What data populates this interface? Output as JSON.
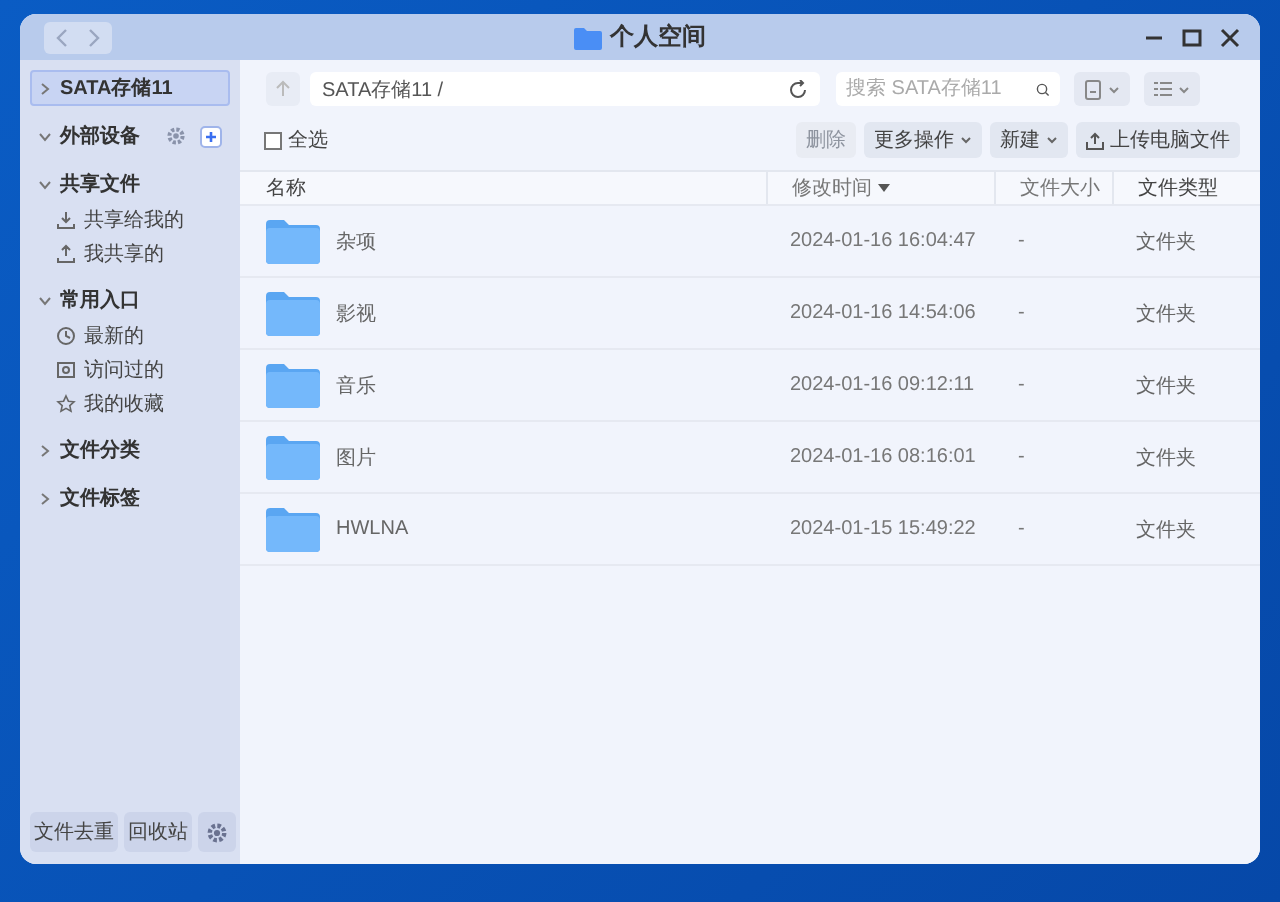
{
  "window": {
    "title": "个人空间"
  },
  "sidebar": {
    "sections": [
      {
        "kind": "storage",
        "label": "SATA存储11",
        "expanded": false,
        "selected": true
      },
      {
        "kind": "devices",
        "label": "外部设备",
        "expanded": true,
        "selected": false
      },
      {
        "kind": "group",
        "label": "共享文件",
        "expanded": true,
        "selected": false,
        "children": [
          {
            "kind": "received",
            "label": "共享给我的",
            "selected": false
          },
          {
            "kind": "shared",
            "label": "我共享的",
            "selected": false
          }
        ]
      },
      {
        "kind": "group",
        "label": "常用入口",
        "expanded": true,
        "selected": false,
        "children": [
          {
            "kind": "recent",
            "label": "最新的",
            "selected": false
          },
          {
            "kind": "visited",
            "label": "访问过的",
            "selected": false
          },
          {
            "kind": "favorite",
            "label": "我的收藏",
            "selected": false
          }
        ]
      },
      {
        "kind": "group",
        "label": "文件分类",
        "expanded": false,
        "selected": false
      },
      {
        "kind": "group",
        "label": "文件标签",
        "expanded": false,
        "selected": false
      }
    ],
    "footer_buttons": [
      "文件去重",
      "回收站"
    ]
  },
  "toolbar": {
    "path": "SATA存储11 /",
    "search": {
      "placeholder": "搜索 SATA存储11"
    }
  },
  "actions": {
    "select_all": {
      "label": "全选",
      "checked": false
    },
    "buttons": [
      {
        "label": "删除",
        "disabled": true,
        "kind": "plain"
      },
      {
        "label": "更多操作",
        "disabled": false,
        "kind": "dropdown"
      },
      {
        "label": "新建",
        "disabled": false,
        "kind": "dropdown"
      },
      {
        "label": "上传电脑文件",
        "disabled": false,
        "kind": "upload"
      }
    ]
  },
  "table": {
    "columns": [
      {
        "label": "名称",
        "sorted": false
      },
      {
        "label": "修改时间",
        "sorted": true
      },
      {
        "label": "文件大小",
        "sorted": false
      },
      {
        "label": "文件类型",
        "sorted": false
      }
    ],
    "rows": [
      {
        "name": "杂项",
        "modified": "2024-01-16 16:04:47",
        "size": "-",
        "type": "文件夹"
      },
      {
        "name": "影视",
        "modified": "2024-01-16 14:54:06",
        "size": "-",
        "type": "文件夹"
      },
      {
        "name": "音乐",
        "modified": "2024-01-16 09:12:11",
        "size": "-",
        "type": "文件夹"
      },
      {
        "name": "图片",
        "modified": "2024-01-16 08:16:01",
        "size": "-",
        "type": "文件夹"
      },
      {
        "name": "HWLNA",
        "modified": "2024-01-15 15:49:22",
        "size": "-",
        "type": "文件夹"
      }
    ]
  }
}
